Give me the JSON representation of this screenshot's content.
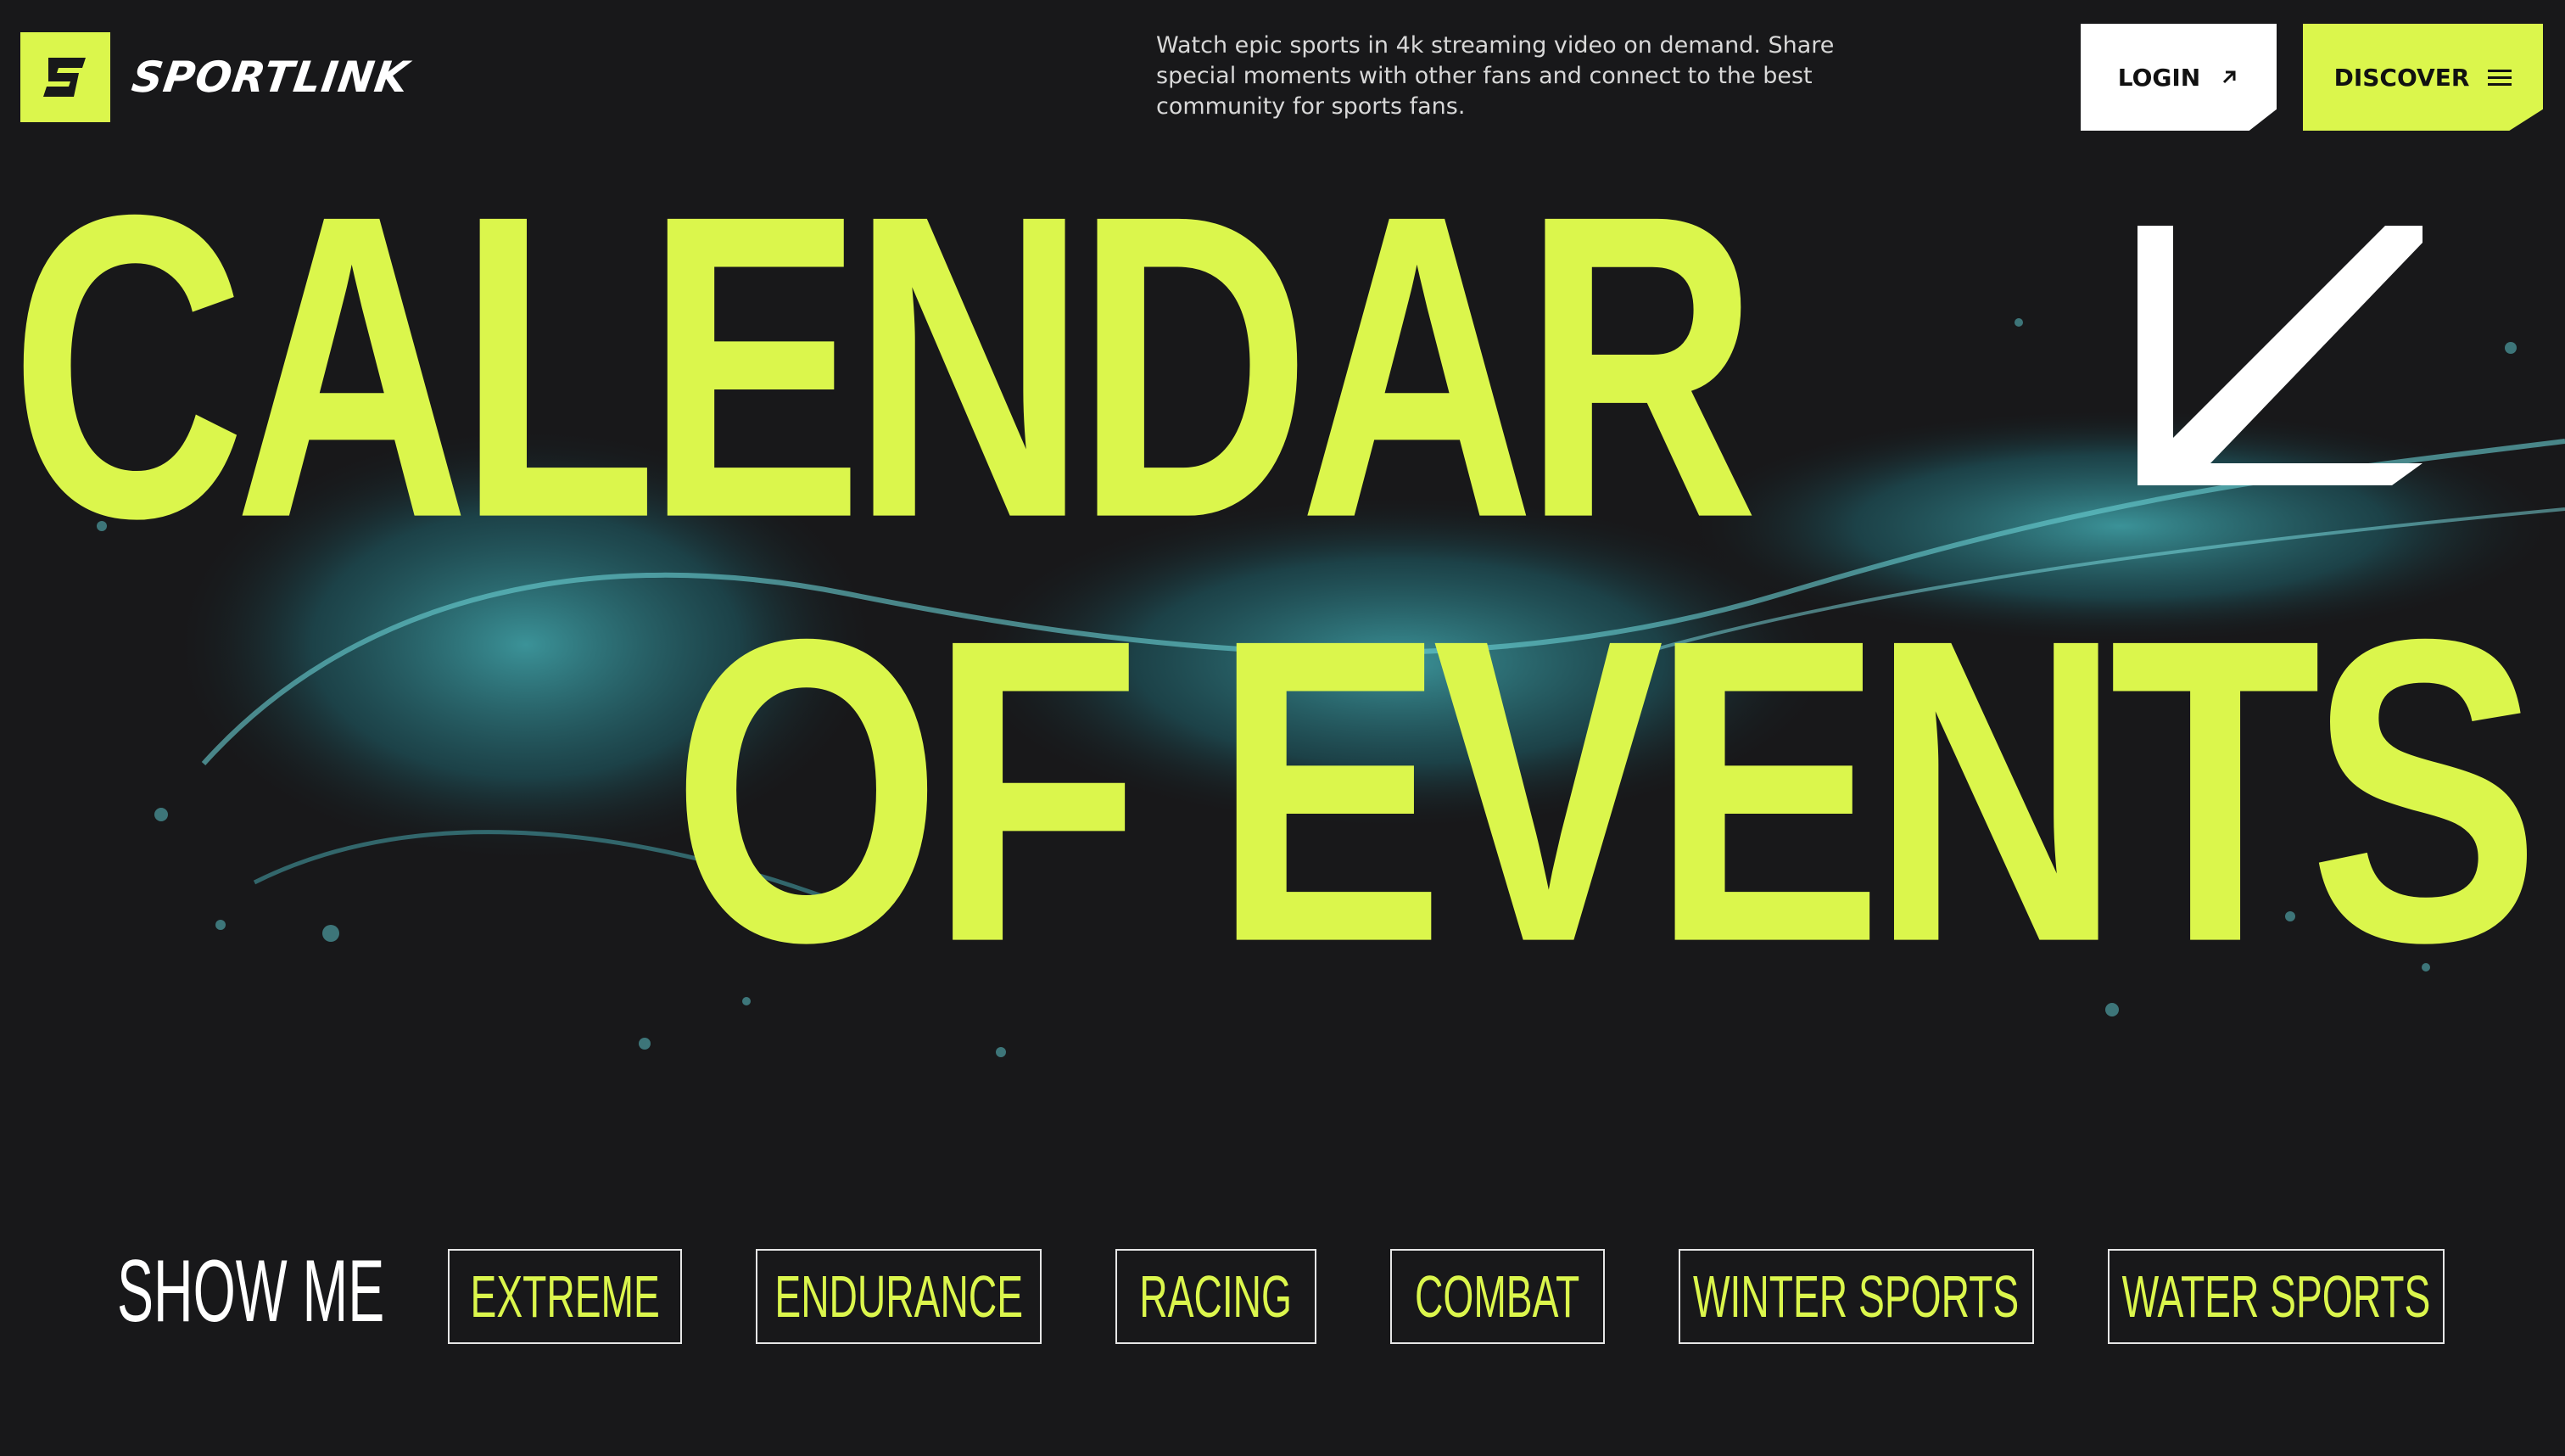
{
  "brand": {
    "name": "SPORTLINK",
    "logo_letter": "S",
    "accent_color": "#dbf64c",
    "background_color": "#18181a"
  },
  "header": {
    "tagline": "Watch epic sports in 4k streaming video on demand. Share special moments with other fans and connect to the best community for sports fans.",
    "login_label": "LOGIN",
    "login_icon": "arrow-up-right-icon",
    "discover_label": "DISCOVER",
    "discover_icon": "hamburger-menu-icon"
  },
  "hero": {
    "line1": "CALENDAR",
    "line2": "OF EVENTS",
    "arrow_icon": "arrow-down-left-icon"
  },
  "filters": {
    "label": "SHOW ME",
    "categories": [
      "EXTREME",
      "ENDURANCE",
      "RACING",
      "COMBAT",
      "WINTER SPORTS",
      "WATER SPORTS"
    ]
  }
}
